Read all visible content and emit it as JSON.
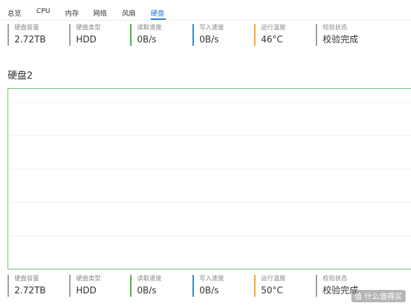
{
  "tabs": [
    {
      "label": "总览",
      "active": false
    },
    {
      "label": "CPU",
      "active": false
    },
    {
      "label": "内存",
      "active": false
    },
    {
      "label": "网络",
      "active": false
    },
    {
      "label": "风扇",
      "active": false
    },
    {
      "label": "硬盘",
      "active": true
    }
  ],
  "disk1": {
    "capacity": {
      "label": "硬盘容量",
      "value": "2.72TB"
    },
    "type": {
      "label": "硬盘类型",
      "value": "HDD"
    },
    "read": {
      "label": "读取速度",
      "value": "0B/s"
    },
    "write": {
      "label": "写入速度",
      "value": "0B/s"
    },
    "temp": {
      "label": "运行温度",
      "value": "46°C"
    },
    "verify": {
      "label": "校验状态",
      "value": "校验完成"
    }
  },
  "disk2": {
    "title": "硬盘2",
    "capacity": {
      "label": "硬盘容量",
      "value": "2.72TB"
    },
    "type": {
      "label": "硬盘类型",
      "value": "HDD"
    },
    "read": {
      "label": "读取速度",
      "value": "0B/s"
    },
    "write": {
      "label": "写入速度",
      "value": "0B/s"
    },
    "temp": {
      "label": "运行温度",
      "value": "50°C"
    },
    "verify": {
      "label": "校验状态",
      "value": "校验完成"
    }
  },
  "colors": {
    "accent": "#1a7ad8",
    "gray_bar": "#9a9a9a",
    "green_bar": "#3cb83c",
    "blue_bar": "#2b7fd8",
    "orange_bar": "#f5a623",
    "chart_border": "#6cbf6c",
    "grid": "#ececec"
  },
  "watermark": "值 什么值得买"
}
